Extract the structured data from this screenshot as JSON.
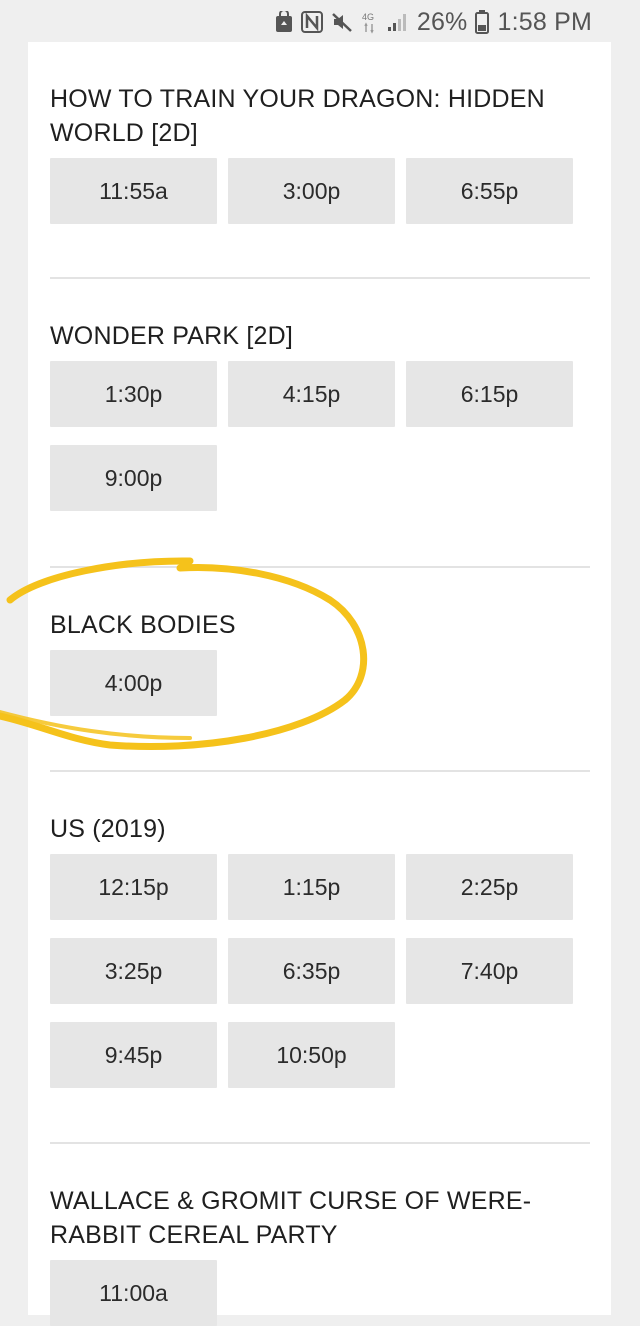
{
  "status_bar": {
    "battery": "26%",
    "time": "1:58 PM",
    "network": "4G"
  },
  "movies": [
    {
      "title": "HOW TO TRAIN YOUR DRAGON: HIDDEN WORLD [2D]",
      "times": [
        "11:55a",
        "3:00p",
        "6:55p"
      ]
    },
    {
      "title": "WONDER PARK [2D]",
      "times": [
        "1:30p",
        "4:15p",
        "6:15p",
        "9:00p"
      ]
    },
    {
      "title": "BLACK BODIES",
      "times": [
        "4:00p"
      ]
    },
    {
      "title": "US (2019)",
      "times": [
        "12:15p",
        "1:15p",
        "2:25p",
        "3:25p",
        "6:35p",
        "7:40p",
        "9:45p",
        "10:50p"
      ]
    },
    {
      "title": "WALLACE & GROMIT CURSE OF WERE-RABBIT CEREAL PARTY",
      "times": [
        "11:00a"
      ]
    }
  ],
  "annotation_color": "#f5c21b"
}
